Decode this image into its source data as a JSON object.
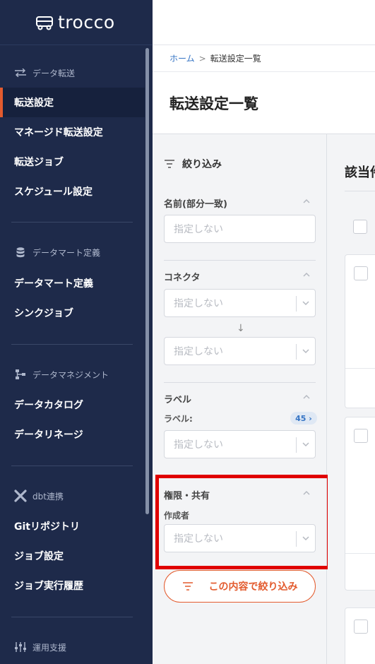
{
  "app": {
    "logo_text": "trocco"
  },
  "sidebar": {
    "sections": [
      {
        "title": "データ転送",
        "icon": "transfer-icon",
        "items": [
          {
            "label": "転送設定",
            "active": true
          },
          {
            "label": "マネージド転送設定"
          },
          {
            "label": "転送ジョブ"
          },
          {
            "label": "スケジュール設定"
          }
        ]
      },
      {
        "title": "データマート定義",
        "icon": "database-icon",
        "items": [
          {
            "label": "データマート定義"
          },
          {
            "label": "シンクジョブ"
          }
        ]
      },
      {
        "title": "データマネジメント",
        "icon": "data-management-icon",
        "items": [
          {
            "label": "データカタログ"
          },
          {
            "label": "データリネージ"
          }
        ]
      },
      {
        "title": "dbt連携",
        "icon": "dbt-icon",
        "items": [
          {
            "label": "Gitリポジトリ"
          },
          {
            "label": "ジョブ設定"
          },
          {
            "label": "ジョブ実行履歴"
          }
        ]
      },
      {
        "title": "運用支援",
        "icon": "operations-icon",
        "items": []
      }
    ]
  },
  "breadcrumb": {
    "home": "ホーム",
    "separator": ">",
    "current": "転送設定一覧"
  },
  "page": {
    "title": "転送設定一覧"
  },
  "filter": {
    "title": "絞り込み",
    "name_label": "名前(部分一致)",
    "name_placeholder": "指定しない",
    "connector_label": "コネクタ",
    "connector_source_placeholder": "指定しない",
    "arrow": "↓",
    "connector_dest_placeholder": "指定しない",
    "label_group": "ラベル",
    "label_sub": "ラベル:",
    "label_count": "45 ›",
    "label_placeholder": "指定しない",
    "permission_group": "権限・共有",
    "creator_label": "作成者",
    "creator_placeholder": "指定しない",
    "apply_button": "この内容で絞り込み"
  },
  "results": {
    "title": "該当件数"
  },
  "colors": {
    "sidebar_bg": "#1e2a4a",
    "accent": "#e35b2e",
    "link": "#3574c4",
    "highlight": "#e00000"
  }
}
